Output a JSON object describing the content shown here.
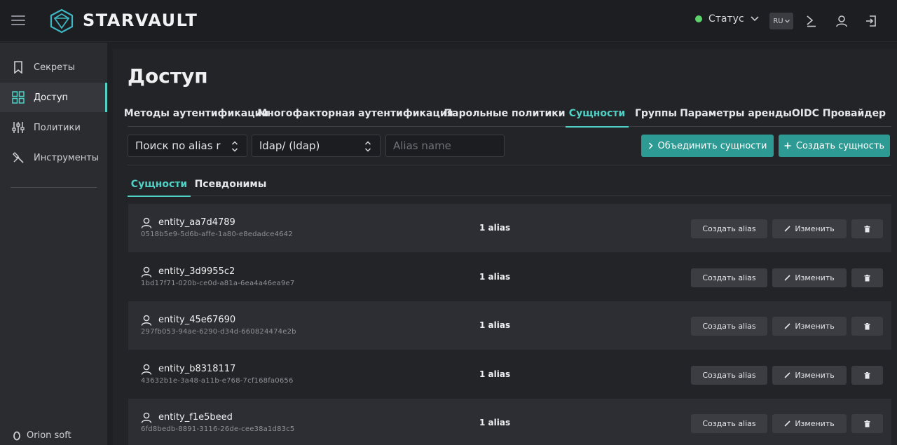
{
  "header": {
    "logo_text": "STARVAULT",
    "status_label": "Статус",
    "status_color": "#5dd36b",
    "lang": "RU",
    "icons": [
      "menu-icon",
      "logo-icon",
      "chevron-down-icon",
      "terminal-icon",
      "user-icon",
      "logout-icon"
    ]
  },
  "sidebar": {
    "items": [
      {
        "label": "Секреты",
        "icon": "bookmark-icon"
      },
      {
        "label": "Доступ",
        "icon": "grid-icon",
        "active": true
      },
      {
        "label": "Политики",
        "icon": "sliders-icon"
      },
      {
        "label": "Инструменты",
        "icon": "tools-icon"
      }
    ],
    "footer": "Orion soft"
  },
  "main": {
    "title": "Доступ",
    "tabs": [
      {
        "label": "Методы аутентификации"
      },
      {
        "label": "Многофакторная аутентификация"
      },
      {
        "label": "Парольные политики"
      },
      {
        "label": "Сущности",
        "active": true
      },
      {
        "label": "Группы"
      },
      {
        "label": "Параметры аренды"
      },
      {
        "label": "OIDC Провайдер"
      }
    ],
    "filters": {
      "search_type": "Поиск по alias r",
      "mount": "ldap/ (ldap)",
      "alias_placeholder": "Alias name",
      "alias_value": ""
    },
    "buttons": {
      "merge": "Объединить сущности",
      "create": "Создать сущность"
    },
    "subtabs": [
      {
        "label": "Сущности",
        "active": true
      },
      {
        "label": "Псевдонимы"
      }
    ],
    "row_buttons": {
      "create_alias": "Создать alias",
      "edit": "Изменить"
    },
    "entities": [
      {
        "name": "entity_aa7d4789",
        "id": "0518b5e9-5d6b-affe-1a80-e8edadce4642",
        "aliases": "1 alias"
      },
      {
        "name": "entity_3d9955c2",
        "id": "1bd17f71-020b-ce0d-a81a-6ea4a46ea9e7",
        "aliases": "1 alias"
      },
      {
        "name": "entity_45e67690",
        "id": "297fb053-94ae-6290-d34d-660824474e2b",
        "aliases": "1 alias"
      },
      {
        "name": "entity_b8318117",
        "id": "43632b1e-3a48-a11b-e768-7cf168fa0656",
        "aliases": "1 alias"
      },
      {
        "name": "entity_f1e5beed",
        "id": "6fd8bedb-8891-3116-26de-cee38a1d83c5",
        "aliases": "1 alias"
      }
    ]
  },
  "colors": {
    "accent": "#4fd1c5",
    "button_teal": "#2d9a93"
  }
}
